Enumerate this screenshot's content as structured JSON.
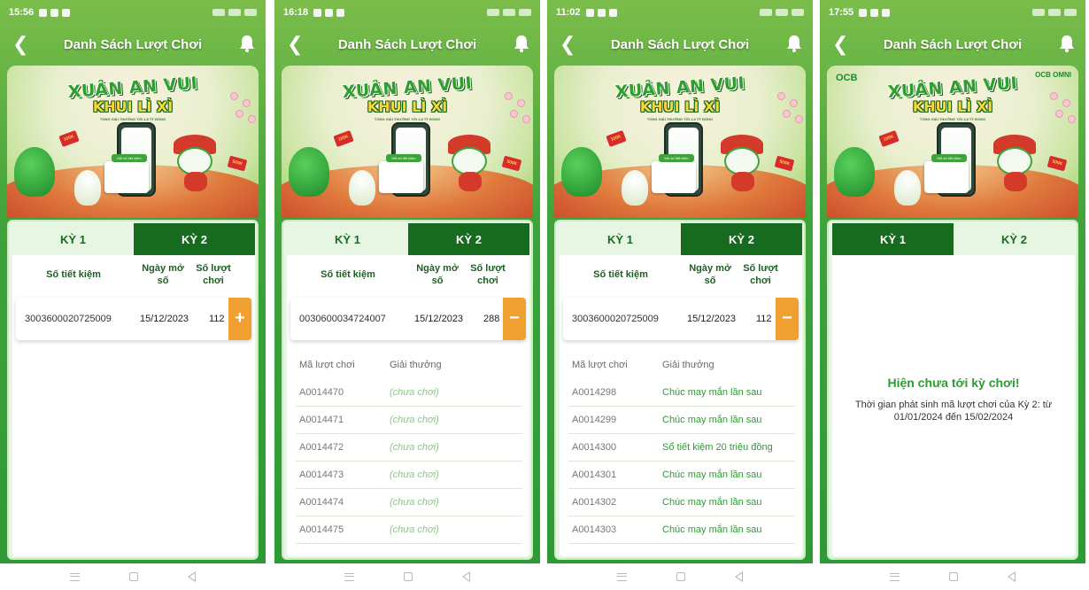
{
  "header": {
    "title": "Danh Sách Lượt Chơi"
  },
  "banner": {
    "headline1": "XUÂN AN VUI",
    "headline2": "KHUI LÌ XÌ",
    "tagline": "TỔNG GIẢI THƯỞNG TỚI 1,8 TỶ ĐỒNG",
    "pill": "Mở số tiết kiệm",
    "env_100": "100K",
    "env_500": "500K",
    "logo_left": "OCB",
    "logo_right": "OCB OMNI"
  },
  "tabs": {
    "tab1": "KỲ 1",
    "tab2": "KỲ 2"
  },
  "columns": {
    "account": "Số tiết kiệm",
    "open_date": "Ngày mở\nsố",
    "plays": "Số lượt\nchơi"
  },
  "sub_columns": {
    "code": "Mã lượt chơi",
    "prize": "Giải thưởng"
  },
  "screens": [
    {
      "time": "15:56",
      "active_tab": 1,
      "account": {
        "number": "3003600020725009",
        "date": "15/12/2023",
        "plays": "112",
        "toggle": "+"
      },
      "plays": []
    },
    {
      "time": "16:18",
      "active_tab": 1,
      "account": {
        "number": "0030600034724007",
        "date": "15/12/2023",
        "plays": "288",
        "toggle": "−"
      },
      "plays": [
        {
          "code": "A0014470",
          "prize": "(chưa chơi)"
        },
        {
          "code": "A0014471",
          "prize": "(chưa chơi)"
        },
        {
          "code": "A0014472",
          "prize": "(chưa chơi)"
        },
        {
          "code": "A0014473",
          "prize": "(chưa chơi)"
        },
        {
          "code": "A0014474",
          "prize": "(chưa chơi)"
        },
        {
          "code": "A0014475",
          "prize": "(chưa chơi)"
        }
      ]
    },
    {
      "time": "11:02",
      "active_tab": 1,
      "account": {
        "number": "3003600020725009",
        "date": "15/12/2023",
        "plays": "112",
        "toggle": "−"
      },
      "plays": [
        {
          "code": "A0014298",
          "prize": "Chúc may mắn lần sau"
        },
        {
          "code": "A0014299",
          "prize": "Chúc may mắn lần sau"
        },
        {
          "code": "A0014300",
          "prize": "Sổ tiết kiệm 20 triệu đồng"
        },
        {
          "code": "A0014301",
          "prize": "Chúc may mắn lần sau"
        },
        {
          "code": "A0014302",
          "prize": "Chúc may mắn lần sau"
        },
        {
          "code": "A0014303",
          "prize": "Chúc may mắn lần sau"
        }
      ]
    },
    {
      "time": "17:55",
      "active_tab": 2,
      "empty_title": "Hiện chưa tới kỳ chơi!",
      "empty_desc": "Thời gian phát sinh mã lượt chơi của Kỳ 2: từ 01/01/2024 đến 15/02/2024"
    }
  ],
  "colors": {
    "primary_green": "#2e9a35",
    "dark_green": "#166b1f",
    "accent_orange": "#f0a030"
  },
  "icons": [
    "back-arrow-icon",
    "bell-icon",
    "plus-icon",
    "minus-icon",
    "menu-icon",
    "home-square-icon",
    "back-triangle-icon"
  ]
}
